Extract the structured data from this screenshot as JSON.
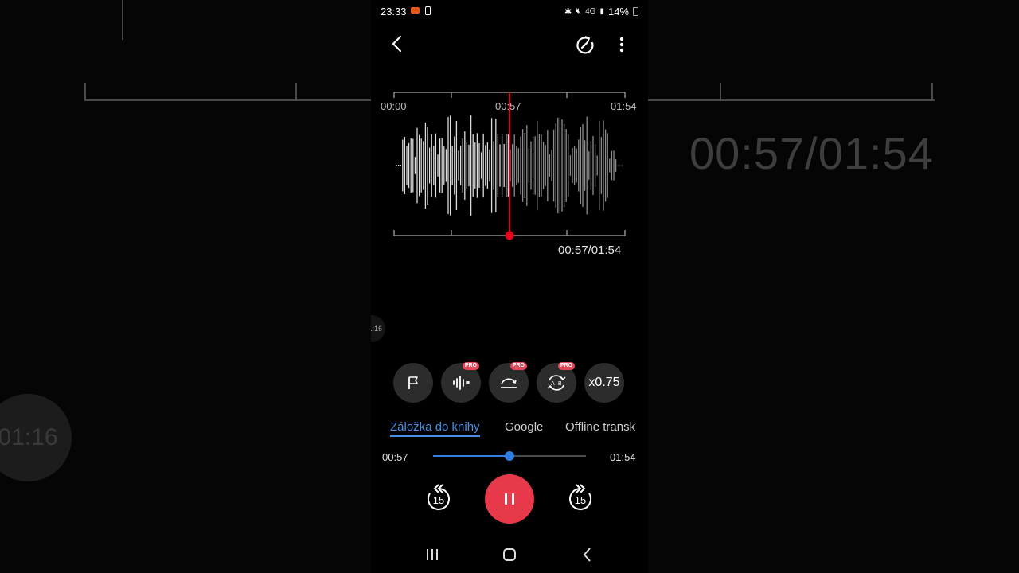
{
  "status_bar": {
    "time": "23:33",
    "network": "4G",
    "battery": "14%"
  },
  "waveform": {
    "tick_start": "00:00",
    "tick_mid": "00:57",
    "tick_end": "01:54",
    "current_label": "00:57/01:54",
    "playhead_fraction": 0.5,
    "accent_color": "#e3001b"
  },
  "side_bubble": "01:16",
  "tools": {
    "pro_badge": "PRO",
    "speed_label": "x0.75",
    "icons": [
      "flag-icon",
      "noise-reduction-icon",
      "skip-silence-icon",
      "ab-repeat-icon"
    ]
  },
  "tabs": [
    "Záložka do knihy",
    "Google",
    "Offline transk"
  ],
  "active_tab": "Záložka do knihy",
  "seek": {
    "elapsed": "00:57",
    "total": "01:54",
    "progress": 0.5,
    "color": "#2f7ee0"
  },
  "playback": {
    "skip_seconds": "15",
    "state": "pause-icon",
    "color": "#e8394a"
  },
  "background": {
    "time_display": "00:57/01:54",
    "bubble": "01:16"
  }
}
